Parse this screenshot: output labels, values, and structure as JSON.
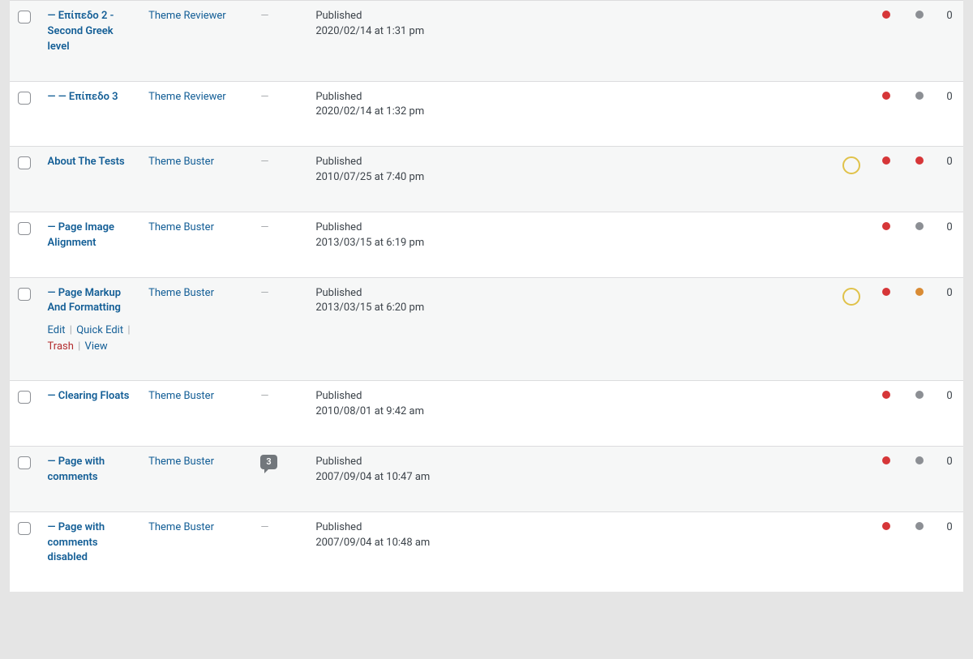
{
  "row_actions": {
    "edit": "Edit",
    "quick_edit": "Quick Edit",
    "trash": "Trash",
    "view": "View"
  },
  "rows": [
    {
      "title": "— Επίπεδο 2 - Second Greek level",
      "author": "Theme Reviewer",
      "comments": "—",
      "status": "Published",
      "date": "2020/02/14 at 1:31 pm",
      "ring": false,
      "dot1": "red",
      "dot2": "gray",
      "count": "0",
      "alt": true,
      "show_actions": false
    },
    {
      "title": "— — Επίπεδο 3",
      "author": "Theme Reviewer",
      "comments": "—",
      "status": "Published",
      "date": "2020/02/14 at 1:32 pm",
      "ring": false,
      "dot1": "red",
      "dot2": "gray",
      "count": "0",
      "alt": false,
      "show_actions": false
    },
    {
      "title": "About The Tests",
      "author": "Theme Buster",
      "comments": "—",
      "status": "Published",
      "date": "2010/07/25 at 7:40 pm",
      "ring": true,
      "dot1": "red",
      "dot2": "red",
      "count": "0",
      "alt": true,
      "show_actions": false
    },
    {
      "title": "— Page Image Alignment",
      "author": "Theme Buster",
      "comments": "—",
      "status": "Published",
      "date": "2013/03/15 at 6:19 pm",
      "ring": false,
      "dot1": "red",
      "dot2": "gray",
      "count": "0",
      "alt": false,
      "show_actions": false
    },
    {
      "title": "— Page Markup And Formatting",
      "author": "Theme Buster",
      "comments": "—",
      "status": "Published",
      "date": "2013/03/15 at 6:20 pm",
      "ring": true,
      "dot1": "red",
      "dot2": "orange",
      "count": "0",
      "alt": true,
      "show_actions": true
    },
    {
      "title": "— Clearing Floats",
      "author": "Theme Buster",
      "comments": "—",
      "status": "Published",
      "date": "2010/08/01 at 9:42 am",
      "ring": false,
      "dot1": "red",
      "dot2": "gray",
      "count": "0",
      "alt": false,
      "show_actions": false
    },
    {
      "title": "— Page with comments",
      "author": "Theme Buster",
      "comments": "3",
      "status": "Published",
      "date": "2007/09/04 at 10:47 am",
      "ring": false,
      "dot1": "red",
      "dot2": "gray",
      "count": "0",
      "alt": true,
      "show_actions": false
    },
    {
      "title": "— Page with comments disabled",
      "author": "Theme Buster",
      "comments": "—",
      "status": "Published",
      "date": "2007/09/04 at 10:48 am",
      "ring": false,
      "dot1": "red",
      "dot2": "gray",
      "count": "0",
      "alt": false,
      "show_actions": false
    }
  ]
}
